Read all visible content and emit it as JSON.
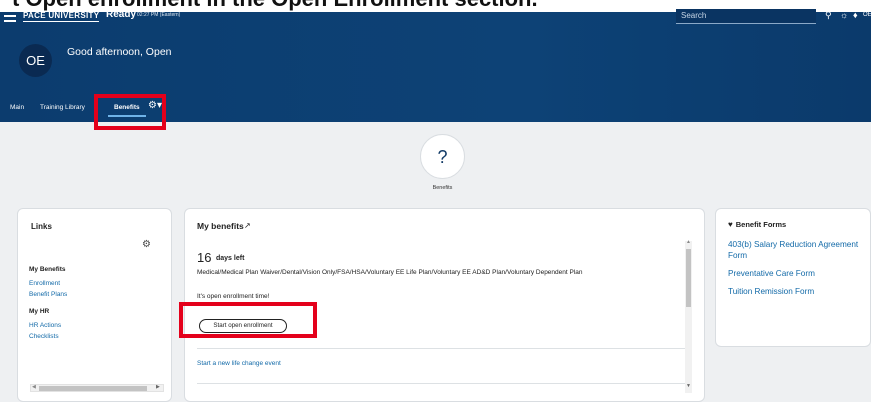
{
  "caption": "t Open enrollment in the Open Enrollment section.",
  "header": {
    "logo": "PACE UNIVERSITY",
    "app_name": "Ready",
    "time": "02:27 PM (Eastern)",
    "search_placeholder": "Search",
    "user_initials_short": "OE"
  },
  "user": {
    "initials": "OE",
    "greeting": "Good afternoon, Open"
  },
  "tabs": [
    {
      "label": "Main"
    },
    {
      "label": "Training Library"
    },
    {
      "label": "Benefits",
      "active": true
    }
  ],
  "page": {
    "icon_label": "Benefits"
  },
  "links_card": {
    "title": "Links",
    "sections": [
      {
        "heading": "My Benefits",
        "items": [
          "Enrollment",
          "Benefit Plans"
        ]
      },
      {
        "heading": "My HR",
        "items": [
          "HR Actions",
          "Checklists"
        ]
      }
    ]
  },
  "my_benefits": {
    "title": "My benefits",
    "days_count": "16",
    "days_suffix": "days left",
    "plans": "Medical/Medical Plan Waiver/Dental/Vision Only/FSA/HSA/Voluntary EE Life Plan/Voluntary EE AD&D Plan/Voluntary Dependent Plan",
    "message": "It's open enrollment time!",
    "start_button": "Start open enrollment",
    "life_event_link": "Start a new life change event"
  },
  "benefit_forms": {
    "title": "Benefit Forms",
    "items": [
      "403(b) Salary Reduction Agreement Form",
      "Preventative Care Form",
      "Tuition Remission Form"
    ]
  },
  "colors": {
    "header_bg": "#0d4276",
    "link": "#136aa8",
    "highlight": "#e4001b"
  }
}
